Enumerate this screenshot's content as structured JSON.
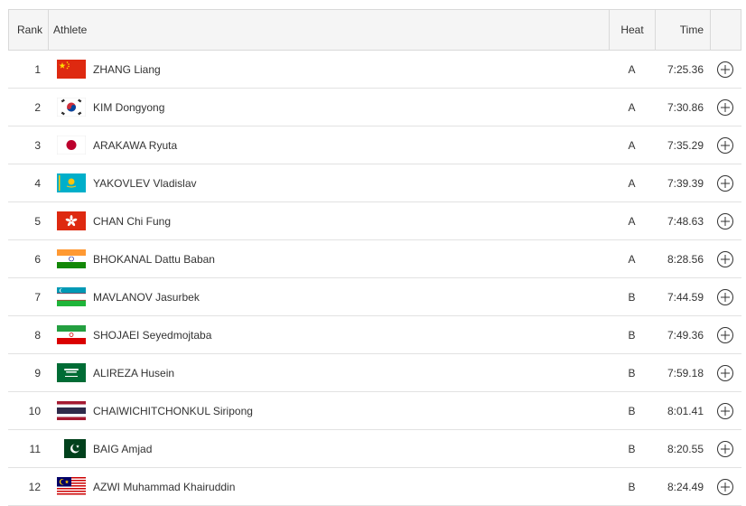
{
  "header": {
    "rank": "Rank",
    "athlete": "Athlete",
    "heat": "Heat",
    "time": "Time"
  },
  "rows": [
    {
      "rank": "1",
      "name": "ZHANG Liang",
      "heat": "A",
      "time": "7:25.36",
      "flag": "china-flag-icon"
    },
    {
      "rank": "2",
      "name": "KIM Dongyong",
      "heat": "A",
      "time": "7:30.86",
      "flag": "south-korea-flag-icon"
    },
    {
      "rank": "3",
      "name": "ARAKAWA Ryuta",
      "heat": "A",
      "time": "7:35.29",
      "flag": "japan-flag-icon"
    },
    {
      "rank": "4",
      "name": "YAKOVLEV Vladislav",
      "heat": "A",
      "time": "7:39.39",
      "flag": "kazakhstan-flag-icon"
    },
    {
      "rank": "5",
      "name": "CHAN Chi Fung",
      "heat": "A",
      "time": "7:48.63",
      "flag": "hong-kong-flag-icon"
    },
    {
      "rank": "6",
      "name": "BHOKANAL Dattu Baban",
      "heat": "A",
      "time": "8:28.56",
      "flag": "india-flag-icon"
    },
    {
      "rank": "7",
      "name": "MAVLANOV Jasurbek",
      "heat": "B",
      "time": "7:44.59",
      "flag": "uzbekistan-flag-icon"
    },
    {
      "rank": "8",
      "name": "SHOJAEI Seyedmojtaba",
      "heat": "B",
      "time": "7:49.36",
      "flag": "iran-flag-icon"
    },
    {
      "rank": "9",
      "name": "ALIREZA Husein",
      "heat": "B",
      "time": "7:59.18",
      "flag": "saudi-arabia-flag-icon"
    },
    {
      "rank": "10",
      "name": "CHAIWICHITCHONKUL Siripong",
      "heat": "B",
      "time": "8:01.41",
      "flag": "thailand-flag-icon"
    },
    {
      "rank": "11",
      "name": "BAIG Amjad",
      "heat": "B",
      "time": "8:20.55",
      "flag": "pakistan-flag-icon"
    },
    {
      "rank": "12",
      "name": "AZWI Muhammad Khairuddin",
      "heat": "B",
      "time": "8:24.49",
      "flag": "malaysia-flag-icon"
    }
  ],
  "icons": {
    "expand": "plus-circle-icon"
  }
}
